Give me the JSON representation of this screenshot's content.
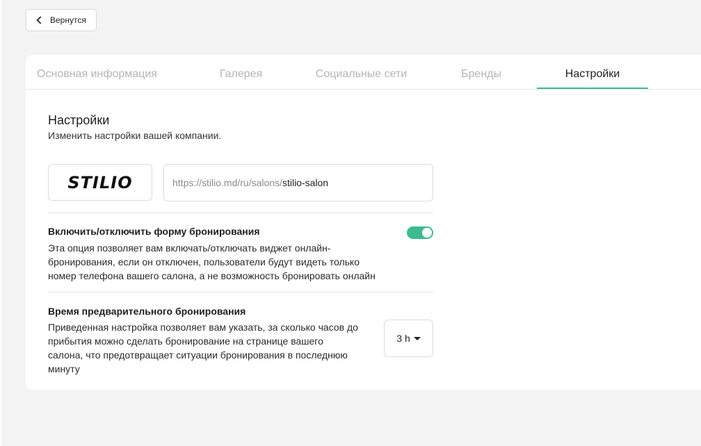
{
  "back_button": {
    "label": "Вернутся"
  },
  "tabs": [
    {
      "label": "Основная информация",
      "active": false
    },
    {
      "label": "Галерея",
      "active": false
    },
    {
      "label": "Социальные сети",
      "active": false
    },
    {
      "label": "Бренды",
      "active": false
    },
    {
      "label": "Настройки",
      "active": true
    }
  ],
  "settings": {
    "title": "Настройки",
    "subtitle": "Изменить настройки вашей компании.",
    "logo_text": "STILIO",
    "url_prefix": "https://stilio.md/ru/salons/",
    "url_slug": "stilio-salon",
    "booking_form": {
      "title": "Включить/отключить форму бронирования",
      "desc_lines": [
        "Эта опция позволяет вам включать/отключать виджет онлайн-",
        "бронирования, если он отключен, пользователи будут видеть только",
        "номер телефона вашего салона, а не возможность бронировать онлайн"
      ],
      "enabled": true
    },
    "prebooking": {
      "title": "Время предварительного бронирования",
      "desc_lines": [
        "Приведенная настройка позволяет вам указать, за сколько часов до",
        "прибытия можно сделать бронирование на странице вашего",
        "салона, что предотвращает ситуации бронирования в последнюю",
        "минуту"
      ],
      "selected_value": "3 h"
    }
  },
  "colors": {
    "accent": "#3dbb8e",
    "page_bg": "#f3f3f3",
    "inactive_tab": "#b5b5b5"
  }
}
